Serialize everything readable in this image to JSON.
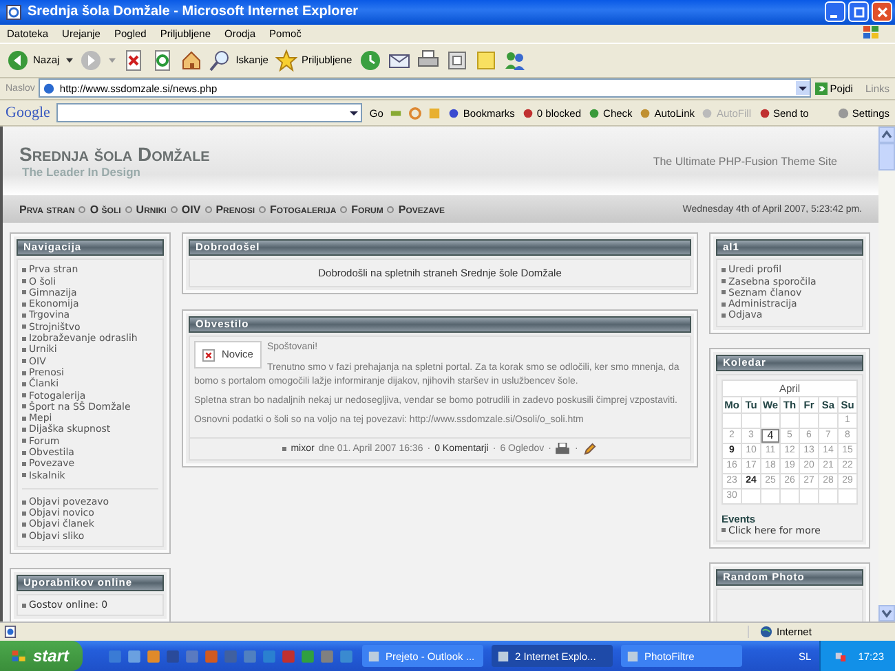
{
  "window": {
    "title": "Srednja šola Domžale - Microsoft Internet Explorer"
  },
  "menu": [
    "Datoteka",
    "Urejanje",
    "Pogled",
    "Priljubljene",
    "Orodja",
    "Pomoč"
  ],
  "toolbar": {
    "back": "Nazaj",
    "search": "Iskanje",
    "favorites": "Priljubljene"
  },
  "address": {
    "label": "Naslov",
    "url": "http://www.ssdomzale.si/news.php",
    "go": "Pojdi",
    "links": "Links"
  },
  "google_bar": {
    "logo": "Google",
    "go": "Go",
    "buttons": [
      {
        "label": "Bookmarks",
        "disabled": false
      },
      {
        "label": "0 blocked",
        "disabled": false
      },
      {
        "label": "Check",
        "disabled": false
      },
      {
        "label": "AutoLink",
        "disabled": false
      },
      {
        "label": "AutoFill",
        "disabled": true
      },
      {
        "label": "Send to",
        "disabled": false
      }
    ],
    "settings": "Settings"
  },
  "site": {
    "title": "Srednja šola Domžale",
    "slogan": "The Leader In Design",
    "tagline": "The Ultimate PHP-Fusion Theme Site",
    "nav": [
      "Prva stran",
      "O šoli",
      "Urniki",
      "OIV",
      "Prenosi",
      "Fotogalerija",
      "Forum",
      "Povezave"
    ],
    "date": "Wednesday 4th of April 2007, 5:23:42 pm."
  },
  "navigation": {
    "title": "Navigacija",
    "links": [
      "Prva stran",
      "O šoli",
      "Gimnazija",
      "Ekonomija",
      "Trgovina",
      "Strojništvo",
      "Izobraževanje odraslih",
      "Urniki",
      "OIV",
      "Prenosi",
      "Članki",
      "Fotogalerija",
      "Šport na SŠ Domžale",
      "Mepi",
      "Dijaška skupnost",
      "Forum",
      "Obvestila",
      "Povezave",
      "Iskalnik"
    ],
    "submit_links": [
      "Objavi povezavo",
      "Objavi novico",
      "Objavi članek",
      "Objavi sliko"
    ]
  },
  "online": {
    "title": "Uporabnikov online",
    "lines": [
      "Gostov online: 0"
    ]
  },
  "welcome": {
    "title": "Dobrodošel",
    "text": "Dobrodošli na spletnih straneh Srednje šole Domžale"
  },
  "news": {
    "title": "Obvestilo",
    "category": "Novice",
    "paragraphs": [
      "Spoštovani!",
      "Trenutno smo v fazi prehajanja na spletni portal. Za ta korak smo se odločili, ker smo mnenja, da bomo s portalom omogočili lažje informiranje dijakov, njihovih staršev in uslužbencev šole.",
      "Spletna stran bo nadaljnih nekaj ur nedosegljiva, vendar se bomo potrudili in zadevo poskusili čimprej vzpostaviti.",
      "Osnovni podatki o šoli so na voljo na tej povezavi: http://www.ssdomzale.si/Osoli/o_soli.htm"
    ],
    "author": "mixor",
    "date": "dne 01. April 2007 16:36",
    "comments": "0 Komentarji",
    "views": "6 Ogledov",
    "separator": "·"
  },
  "user_panel": {
    "title": "al1",
    "links": [
      "Uredi profil",
      "Zasebna sporočila",
      "Seznam članov",
      "Administracija",
      "Odjava"
    ]
  },
  "calendar": {
    "title": "Koledar",
    "month": "April",
    "weekdays": [
      "Mo",
      "Tu",
      "We",
      "Th",
      "Fr",
      "Sa",
      "Su"
    ],
    "weeks": [
      [
        {
          "day": "1",
          "today": false,
          "event": false
        }
      ],
      [
        {
          "day": "2",
          "today": false,
          "event": false
        },
        {
          "day": "3",
          "today": false,
          "event": false
        },
        {
          "day": "4",
          "today": true,
          "event": false
        },
        {
          "day": "5",
          "today": false,
          "event": false
        },
        {
          "day": "6",
          "today": false,
          "event": false
        },
        {
          "day": "7",
          "today": false,
          "event": false
        },
        {
          "day": "8",
          "today": false,
          "event": false
        }
      ],
      [
        {
          "day": "9",
          "today": false,
          "event": true
        },
        {
          "day": "10",
          "today": false,
          "event": false
        },
        {
          "day": "11",
          "today": false,
          "event": false
        },
        {
          "day": "12",
          "today": false,
          "event": false
        },
        {
          "day": "13",
          "today": false,
          "event": false
        },
        {
          "day": "14",
          "today": false,
          "event": false
        },
        {
          "day": "15",
          "today": false,
          "event": false
        }
      ],
      [
        {
          "day": "16",
          "today": false,
          "event": false
        },
        {
          "day": "17",
          "today": false,
          "event": false
        },
        {
          "day": "18",
          "today": false,
          "event": false
        },
        {
          "day": "19",
          "today": false,
          "event": false
        },
        {
          "day": "20",
          "today": false,
          "event": false
        },
        {
          "day": "21",
          "today": false,
          "event": false
        },
        {
          "day": "22",
          "today": false,
          "event": false
        }
      ],
      [
        {
          "day": "23",
          "today": false,
          "event": false
        },
        {
          "day": "24",
          "today": false,
          "event": true
        },
        {
          "day": "25",
          "today": false,
          "event": false
        },
        {
          "day": "26",
          "today": false,
          "event": false
        },
        {
          "day": "27",
          "today": false,
          "event": false
        },
        {
          "day": "28",
          "today": false,
          "event": false
        },
        {
          "day": "29",
          "today": false,
          "event": false
        }
      ],
      [
        {
          "day": "30",
          "today": false,
          "event": false
        }
      ]
    ],
    "events_title": "Events",
    "events_link": "Click here for more"
  },
  "random_photo": {
    "title": "Random Photo"
  },
  "status_bar": {
    "zone": "Internet"
  },
  "taskbar": {
    "start": "start",
    "tasks": [
      {
        "label": "Prejeto - Outlook ...",
        "selected": false
      },
      {
        "label": "2 Internet Explo...",
        "selected": true
      },
      {
        "label": "PhotoFiltre",
        "selected": false
      }
    ],
    "language": "SL",
    "clock": "17:23"
  }
}
